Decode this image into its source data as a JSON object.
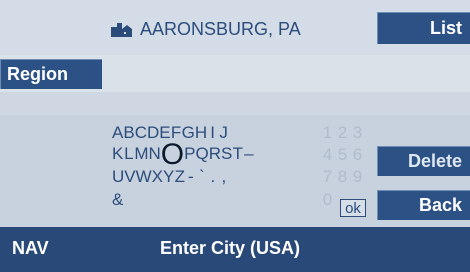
{
  "header": {
    "city": "AARONSBURG, PA",
    "city_icon": "city-skyline-icon"
  },
  "buttons": {
    "list": "List",
    "region": "Region",
    "delete": "Delete",
    "back": "Back"
  },
  "keyboard": {
    "row1_letters": [
      "A",
      "B",
      "C",
      "D",
      "E",
      "F",
      "G",
      "H",
      "I",
      "J"
    ],
    "row1_digits": [
      "1",
      "2",
      "3"
    ],
    "row2_letters": [
      "K",
      "L",
      "M",
      "N",
      "O",
      "P",
      "Q",
      "R",
      "S",
      "T",
      "–"
    ],
    "row2_digits": [
      "4",
      "5",
      "6"
    ],
    "row3_letters": [
      "U",
      "V",
      "W",
      "X",
      "Y",
      "Z",
      "-",
      "`",
      ".",
      ","
    ],
    "row3_digits": [
      "7",
      "8",
      "9"
    ],
    "row4_letters": [
      "&"
    ],
    "row4_digits": [
      "0"
    ],
    "ok": "ok",
    "selected": "O"
  },
  "status_bar": {
    "mode": "NAV",
    "prompt": "Enter City (USA)"
  }
}
